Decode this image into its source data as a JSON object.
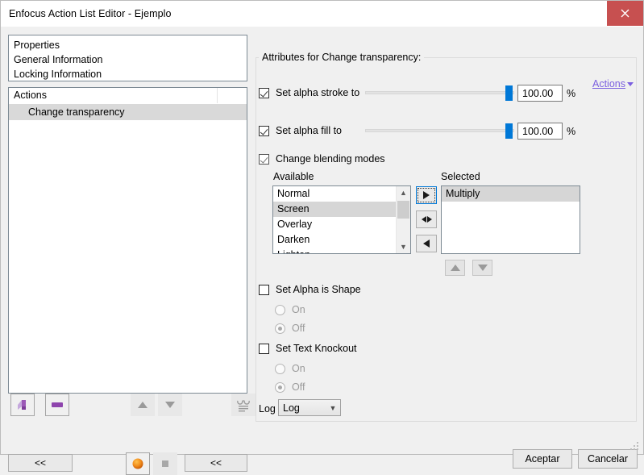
{
  "window": {
    "title": "Enfocus Action List Editor - Ejemplo",
    "close_icon": "close-icon"
  },
  "left": {
    "properties": [
      "Properties",
      "General Information",
      "Locking Information"
    ],
    "actions_header": "Actions",
    "actions_header_col2": "",
    "action_items": [
      "Change transparency"
    ],
    "toolbar": {
      "add_action_icon": "add-action-icon",
      "remove_action_icon": "remove-action-icon",
      "move_up_icon": "move-up-icon",
      "move_down_icon": "move-down-icon",
      "check_icon": "check-on-icon",
      "stop_icon": "stop-icon",
      "preview_icon": "preview-glasses-icon",
      "collapse_left_label": "<<",
      "collapse_right_label": "<<"
    }
  },
  "attributes": {
    "group_title": "Attributes for Change transparency:",
    "actions_link": "Actions",
    "alpha_stroke": {
      "label": "Set alpha stroke to",
      "checked": true,
      "value": "100.00",
      "unit": "%"
    },
    "alpha_fill": {
      "label": "Set alpha fill to",
      "checked": true,
      "value": "100.00",
      "unit": "%"
    },
    "blending": {
      "label": "Change blending modes",
      "checked": true,
      "available_label": "Available",
      "selected_label": "Selected",
      "available": [
        "Normal",
        "Screen",
        "Overlay",
        "Darken",
        "Lighten"
      ],
      "available_selected": "Screen",
      "selected": [
        "Multiply"
      ],
      "selected_highlight": "Multiply",
      "add_icon": "arrow-right-icon",
      "add_all_icon": "arrow-left-right-icon",
      "remove_icon": "arrow-left-icon",
      "order_up_icon": "triangle-up-icon",
      "order_down_icon": "triangle-down-icon"
    },
    "alpha_is_shape": {
      "label": "Set Alpha is Shape",
      "checked": false,
      "on_label": "On",
      "off_label": "Off",
      "selected": "Off"
    },
    "text_knockout": {
      "label": "Set Text Knockout",
      "checked": false,
      "on_label": "On",
      "off_label": "Off",
      "selected": "Off"
    },
    "log": {
      "label": "Log",
      "value": "Log",
      "chevron_icon": "chevron-down-icon"
    }
  },
  "footer": {
    "ok_label": "Aceptar",
    "cancel_label": "Cancelar",
    "resize_grip": "resize-grip-icon"
  },
  "colors": {
    "accent_blue": "#0078d7",
    "close_red": "#c75050",
    "link_purple": "#7b5fe0",
    "selection_gray": "#d6d6d6",
    "window_bg": "#f0f0f0"
  }
}
